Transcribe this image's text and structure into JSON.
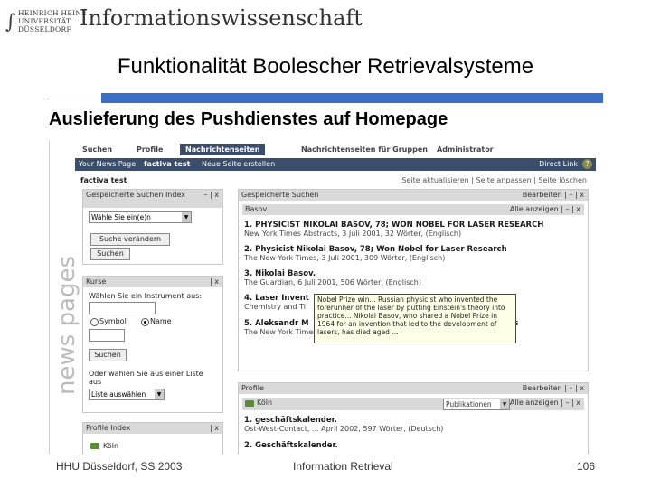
{
  "header": {
    "uni_lines": "HEINRICH HEINE\nUNIVERSITÄT\nDÜSSELDORF",
    "brand": "Informationswissenschaft",
    "slide_title": "Funktionalität Boolescher Retrievalsysteme",
    "section_title": "Auslieferung des Pushdienstes auf Homepage"
  },
  "app": {
    "tabs": [
      "Suchen",
      "Profile",
      "Nachrichtenseiten",
      "Nachrichtenseiten für Gruppen",
      "Administrator"
    ],
    "subnav": [
      "Your News Page",
      "factiva test",
      "Neue Seite erstellen"
    ],
    "direct_link": "Direct Link",
    "help": "?",
    "watermark": "news pages",
    "page_name": "factiva test",
    "page_links": "Seite aktualisieren | Seite anpassen | Seite löschen"
  },
  "left": {
    "saved": {
      "title": "Gespeicherte Suchen Index",
      "controls": "– | x",
      "select_value": "Wähle Sie ein(e)n",
      "edit_button": "Suche verändern",
      "search_button": "Suchen"
    },
    "kurse": {
      "title": "Kurse",
      "controls": "| x",
      "prompt": "Wählen Sie ein Instrument aus:",
      "radio_symbol": "Symbol",
      "radio_name": "Name",
      "search_button": "Suchen",
      "list_prompt": "Oder wählen Sie aus einer Liste aus",
      "list_select": "Liste auswählen"
    },
    "profil_index": {
      "title": "Profile Index",
      "controls": "| x",
      "item": "Köln"
    }
  },
  "right": {
    "saved_searches": {
      "title": "Gespeicherte Suchen",
      "controls": "Bearbeiten | – | x",
      "sub_title": "Basov",
      "sub_controls": "Alle anzeigen | – | x",
      "results": [
        {
          "title": "1. PHYSICIST NIKOLAI BASOV, 78; WON NOBEL FOR LASER RESEARCH",
          "source": "New York Times Abstracts, 3 Juli 2001, 32 Wörter, (Englisch)"
        },
        {
          "title": "2. Physicist Nikolai Basov, 78; Won Nobel for Laser Research",
          "source": "The New York Times, 3 Juli 2001, 309 Wörter, (Englisch)"
        },
        {
          "title": "3. Nikolai Basov.",
          "source": "The Guardian, 6 Juli 2001, 506 Wörter, (Englisch)"
        },
        {
          "title": "4. Laser Invent",
          "source": "Chemistry and Ti"
        },
        {
          "title": "5. Aleksandr M",
          "suffix": "rs",
          "source": "The New York Times, 9 Januar 2002, 447 Wörter, (Englisch)"
        }
      ],
      "tooltip": "Nobel Prize win... Russian physicist who invented the forerunner of the laser by putting Einstein's theory into practice... Nikolai Basov, who shared a Nobel Prize in 1964 for an invention that led to the development of lasers, has died aged ..."
    },
    "profile": {
      "title": "Profile",
      "controls": "Bearbeiten | – | x",
      "sub_title": "Köln",
      "sub_select": "Publikationen",
      "sub_controls": "Alle anzeigen | – | x",
      "results": [
        {
          "title": "1. geschäftskalender.",
          "source": "Ost-West-Contact, ... April 2002, 597 Wörter, (Deutsch)"
        },
        {
          "title": "2. Geschäftskalender.",
          "source": ""
        }
      ]
    }
  },
  "footer": {
    "left": "HHU Düsseldorf, SS 2003",
    "center": "Information Retrieval",
    "page": "106"
  },
  "colors": {
    "accent_bar": "#3b6fc7",
    "nav_dark": "#3a4d6b",
    "panel_head": "#d9d9d9"
  }
}
